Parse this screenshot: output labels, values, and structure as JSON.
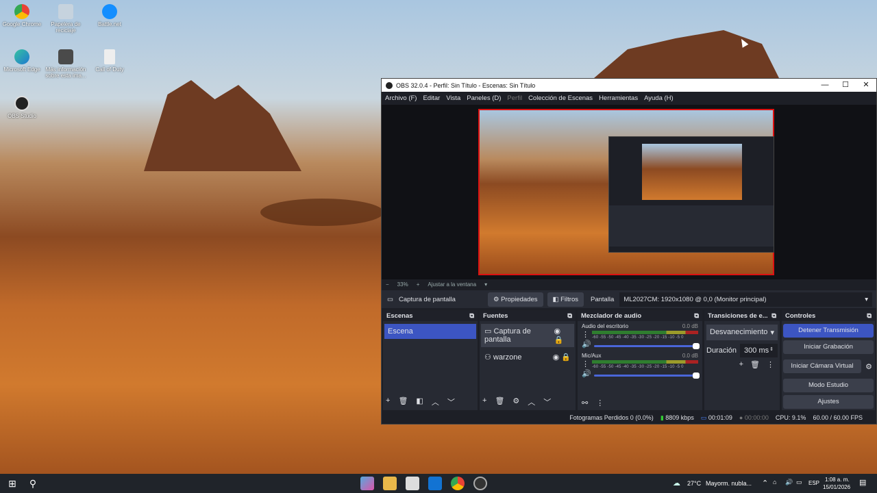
{
  "desktop": {
    "icons": [
      {
        "label": "Google Chrome",
        "color": "#ea4335"
      },
      {
        "label": "Papelera de reciclaje",
        "color": "#9fb6c8"
      },
      {
        "label": "Battle.net",
        "color": "#148eff"
      },
      {
        "label": "Microsoft Edge",
        "color": "#1fa0d8"
      },
      {
        "label": "Más información sobre esta ima...",
        "color": "#555"
      },
      {
        "label": "Call of Duty",
        "color": "#ddd"
      },
      {
        "label": "OBS Studio",
        "color": "#222"
      }
    ]
  },
  "obs": {
    "title": "OBS 32.0.4 - Perfil: Sin Título - Escenas: Sin Título",
    "window_controls": {
      "minimize": "—",
      "maximize": "☐",
      "close": "✕"
    },
    "menu": [
      "Archivo (F)",
      "Editar",
      "Vista",
      "Paneles (D)",
      "Perfil",
      "Colección de Escenas",
      "Herramientas",
      "Ayuda (H)"
    ],
    "zoom": {
      "minus": "−",
      "percent": "33%",
      "plus": "+",
      "fit": "Ajustar a la ventana"
    },
    "source_bar": {
      "selected_source": "Captura de pantalla",
      "properties": "Propiedades",
      "filters": "Filtros",
      "display_label": "Pantalla",
      "display_value": "ML2027CM: 1920x1080 @ 0,0 (Monitor principal)"
    },
    "scenes": {
      "title": "Escenas",
      "items": [
        "Escena"
      ]
    },
    "sources": {
      "title": "Fuentes",
      "items": [
        "Captura de pantalla",
        "warzone"
      ]
    },
    "mixer": {
      "title": "Mezclador de audio",
      "scale": "-60 -55 -50 -45 -40 -35 -30 -25 -20 -15 -10 -5 0",
      "channels": [
        {
          "name": "Audio del escritorio",
          "db": "0.0 dB"
        },
        {
          "name": "Mic/Aux",
          "db": "0.0 dB"
        }
      ]
    },
    "transitions": {
      "title": "Transiciones de e...",
      "selected": "Desvanecimiento",
      "duration_label": "Duración",
      "duration_value": "300 ms"
    },
    "controls": {
      "title": "Controles",
      "buttons": [
        "Detener Transmisión",
        "Iniciar Grabación",
        "Iniciar Cámara Virtual",
        "Modo Estudio",
        "Ajustes"
      ],
      "accent": "#3c55c2"
    },
    "status": {
      "dropped": "Fotogramas Perdidos 0 (0.0%)",
      "bitrate": "8809 kbps",
      "stream_time": "00:01:09",
      "rec_time": "00:00:00",
      "cpu": "CPU: 9.1%",
      "fps": "60.00 / 60.00 FPS"
    }
  },
  "taskbar": {
    "weather": "27°C",
    "weather_text": "Mayorm. nubla...",
    "lang": "ESP",
    "time": "1:08 a. m.",
    "date": "15/01/2026"
  }
}
